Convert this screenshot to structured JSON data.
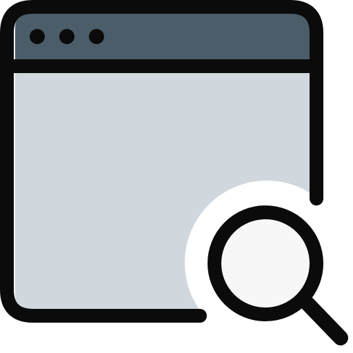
{
  "icon": {
    "name": "browser-window-search-icon",
    "parts": {
      "window": "browser-window-icon",
      "title_bar": "title-bar",
      "dots": [
        "window-dot-1",
        "window-dot-2",
        "window-dot-3"
      ],
      "search": "magnifying-glass-icon"
    }
  },
  "colors": {
    "outline": "#0b0b0b",
    "title_bar": "#4a5d69",
    "window_body": "#d0d8dd",
    "lens": "#f7f7f7",
    "knockout": "#ffffff"
  }
}
